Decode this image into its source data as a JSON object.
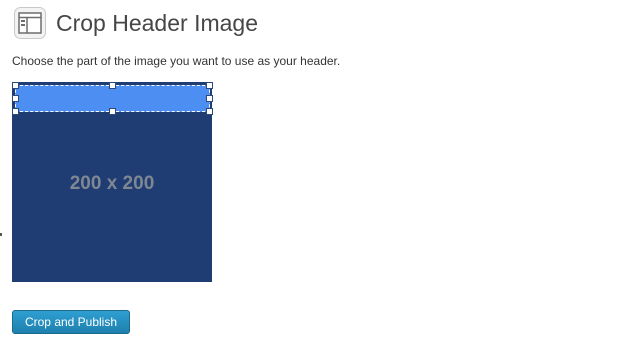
{
  "header": {
    "icon": "appearance-header-icon",
    "title": "Crop Header Image"
  },
  "instructions": "Choose the part of the image you want to use as your header.",
  "crop_area": {
    "placeholder_label": "200 x 200",
    "colors": {
      "background": "#1f3d73",
      "selection": "#4c8ef2"
    }
  },
  "actions": {
    "crop_publish_label": "Crop and Publish",
    "button_color": "#2a95c5"
  }
}
